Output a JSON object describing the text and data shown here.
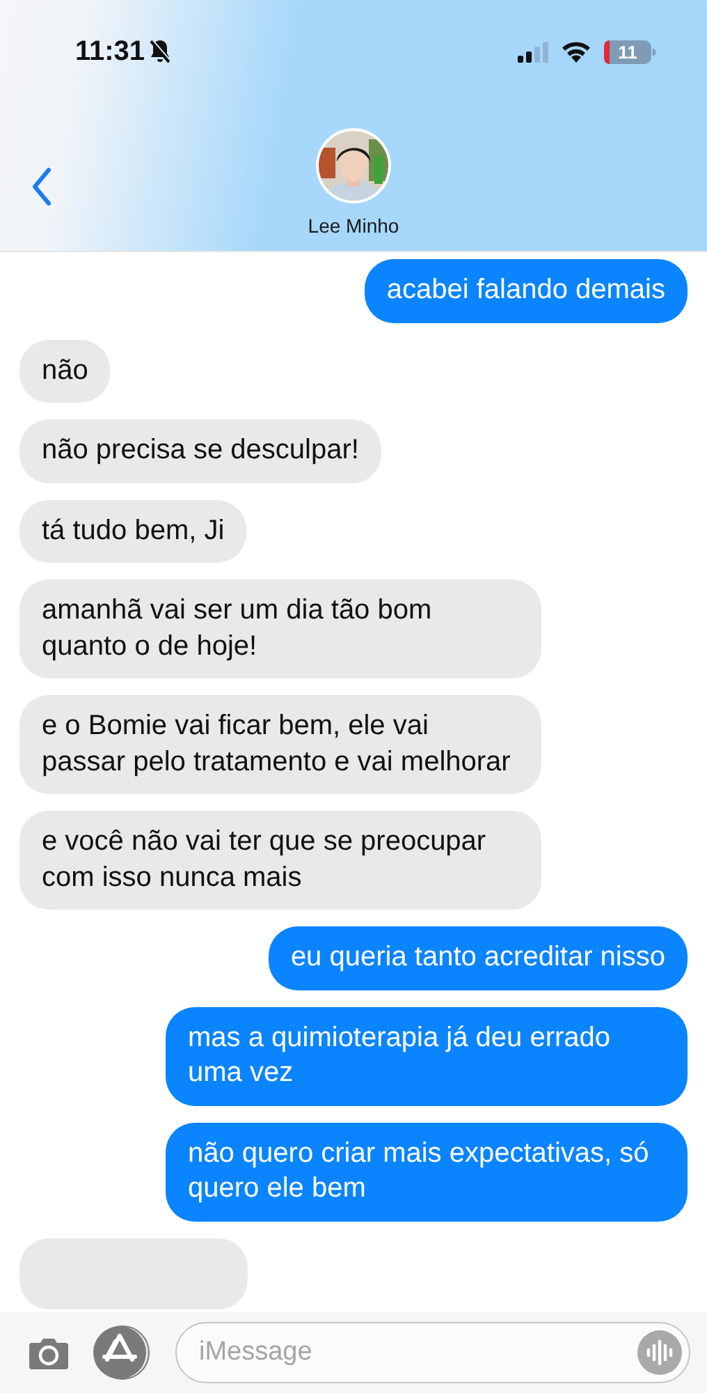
{
  "status_bar": {
    "time": "11:31",
    "battery": "11"
  },
  "header": {
    "contact_name": "Lee Minho"
  },
  "messages": [
    {
      "kind": "sent",
      "text": "acabei falando demais"
    },
    {
      "kind": "received",
      "text": "não"
    },
    {
      "kind": "received",
      "text": "não precisa se desculpar!"
    },
    {
      "kind": "received",
      "text": "tá tudo bem, Ji"
    },
    {
      "kind": "received",
      "text": "amanhã vai ser um dia tão bom quanto o de hoje!"
    },
    {
      "kind": "received",
      "text": "e o Bomie vai ficar bem, ele vai passar pelo tratamento e vai melhorar"
    },
    {
      "kind": "received",
      "text": "e você não vai ter que se preocupar com isso nunca mais"
    },
    {
      "kind": "sent",
      "text": "eu queria tanto acreditar nisso"
    },
    {
      "kind": "sent",
      "text": "mas a quimioterapia já deu errado uma vez"
    },
    {
      "kind": "sent",
      "text": "não quero criar mais expectativas, só quero ele bem"
    },
    {
      "kind": "received"
    }
  ],
  "compose": {
    "placeholder": "iMessage"
  }
}
